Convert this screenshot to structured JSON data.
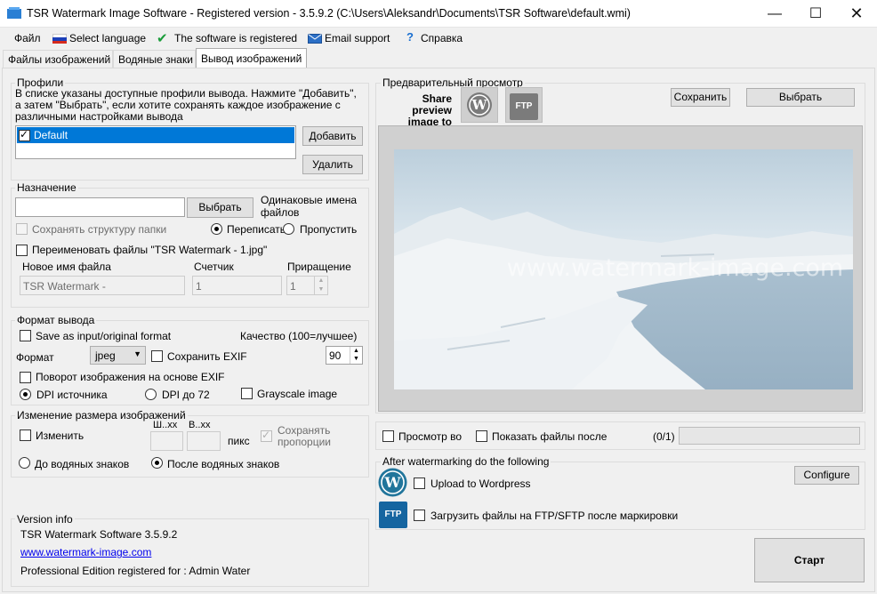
{
  "window": {
    "title": "TSR Watermark Image Software - Registered version - 3.5.9.2 (C:\\Users\\Aleksandr\\Documents\\TSR Software\\default.wmi)"
  },
  "menu": {
    "file": "Файл",
    "language": "Select language",
    "registered": "The software is registered",
    "email": "Email support",
    "help": "Справка"
  },
  "tabs": [
    "Файлы изображений",
    "Водяные знаки",
    "Вывод изображений"
  ],
  "profiles": {
    "title": "Профили",
    "desc": "В списке указаны доступные профили вывода. Нажмите \"Добавить\", а затем \"Выбрать\", если хотите сохранять каждое изображение с различными настройками вывода",
    "items": [
      "Default"
    ],
    "add": "Добавить",
    "remove": "Удалить"
  },
  "destination": {
    "title": "Назначение",
    "browse": "Выбрать",
    "same_names": "Одинаковые имена файлов",
    "keep_structure": "Сохранять структуру папки",
    "overwrite": "Переписать",
    "skip": "Пропустить",
    "rename": "Переименовать файлы \"TSR Watermark - 1.jpg\"",
    "new_name_label": "Новое имя файла",
    "counter_label": "Счетчик",
    "increment_label": "Приращение",
    "new_name_value": "TSR Watermark -",
    "counter_value": "1",
    "increment_value": "1"
  },
  "format": {
    "title": "Формат вывода",
    "save_as_input": "Save as input/original format",
    "quality_label": "Качество (100=лучшее)",
    "format_label": "Формат",
    "format_value": "jpeg",
    "keep_exif": "Сохранить EXIF",
    "quality_value": "90",
    "rotate_exif": "Поворот изображения на основе EXIF",
    "dpi_source": "DPI источника",
    "dpi_72": "DPI до 72",
    "grayscale": "Grayscale image"
  },
  "resize": {
    "title": "Изменение размера изображений",
    "change": "Изменить",
    "w_label": "Ш..xx",
    "h_label": "В..xx",
    "px": "пикс",
    "keep_proportions": "Сохранять пропорции",
    "before_wm": "До водяных знаков",
    "after_wm": "После водяных знаков"
  },
  "version": {
    "title": "Version info",
    "line1": "TSR Watermark Software 3.5.9.2",
    "link": "www.watermark-image.com",
    "line3": "Professional Edition registered for : Admin Water"
  },
  "preview": {
    "title": "Предварительный просмотр",
    "share": "Share preview image to",
    "ftp_icon_text": "FTP",
    "save": "Сохранить",
    "choose": "Выбрать",
    "watermark_text": "www.watermark-image.com"
  },
  "bottom": {
    "preview_in": "Просмотр во",
    "show_files_after": "Показать файлы после",
    "progress": "(0/1)",
    "progress_fraction": 0
  },
  "after": {
    "title": "After watermarking do the following",
    "upload_wp": "Upload to Wordpress",
    "configure": "Configure",
    "upload_ftp": "Загрузить файлы на FTP/SFTP после маркировки",
    "ftp_icon_text": "FTP"
  },
  "start": "Старт",
  "colors": {
    "selection": "#0078d7",
    "wp_blue": "#21759b",
    "ftp_blue": "#1565a0"
  }
}
